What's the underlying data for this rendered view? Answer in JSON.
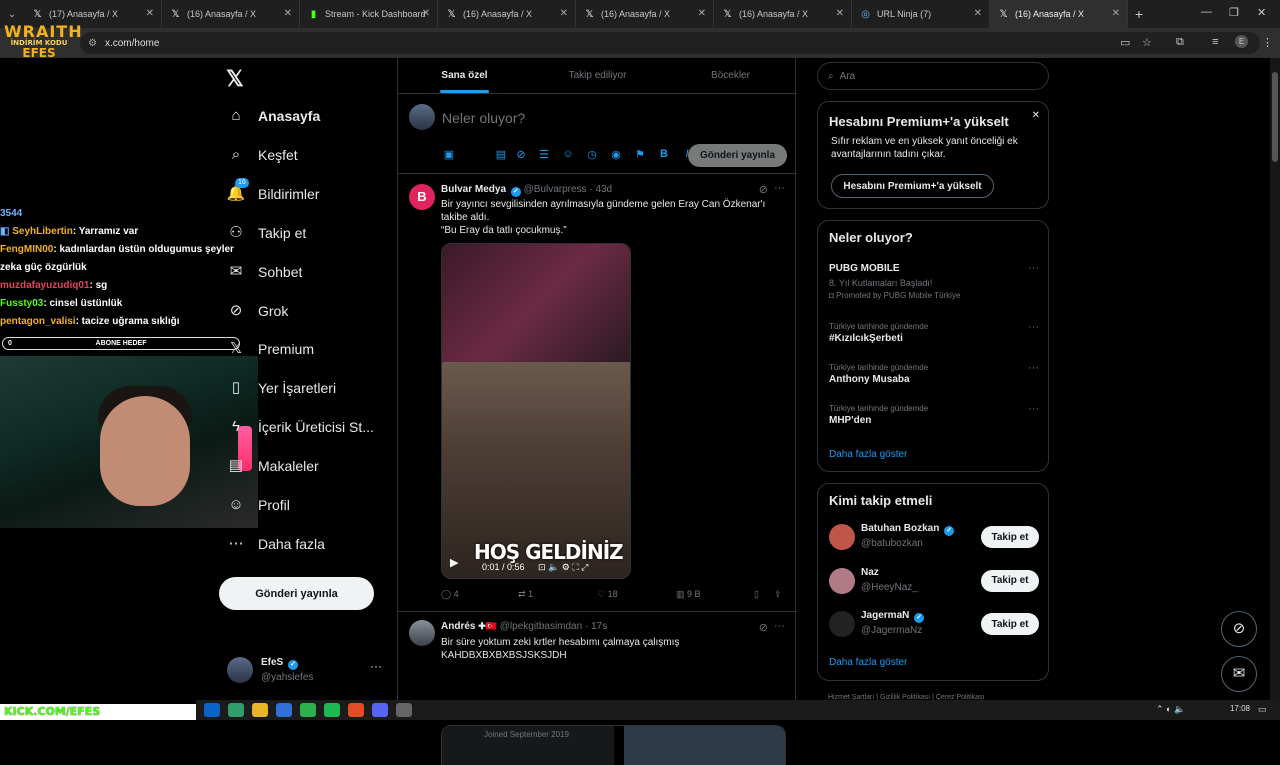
{
  "browser": {
    "tabs": [
      {
        "title": "(17) Anasayfa / X",
        "icon": "x-logo-icon",
        "active": false
      },
      {
        "title": "(16) Anasayfa / X",
        "icon": "x-logo-icon",
        "active": false
      },
      {
        "title": "Stream - Kick Dashboard",
        "icon": "kick-icon",
        "active": false
      },
      {
        "title": "(16) Anasayfa / X",
        "icon": "x-logo-icon",
        "active": false
      },
      {
        "title": "(16) Anasayfa / X",
        "icon": "x-logo-icon",
        "active": false
      },
      {
        "title": "(16) Anasayfa / X",
        "icon": "x-logo-icon",
        "active": false
      },
      {
        "title": "URL Ninja (7)",
        "icon": "globe-icon",
        "active": false
      },
      {
        "title": "(16) Anasayfa / X",
        "icon": "x-logo-icon",
        "active": true
      }
    ],
    "url": "x.com/home",
    "profile_initial": "E"
  },
  "overlay": {
    "logo_line1": "WRAITH",
    "logo_line2": "İNDİRİM KODU",
    "logo_line3": "EFES",
    "chat_count": "3544",
    "chat": [
      {
        "user": "SeyhLibertin",
        "color": "#f3b21b",
        "text": ": Yarramız var"
      },
      {
        "user": "FengMIN00",
        "color": "#f3b21b",
        "text": ": kadınlardan üstün oldugumus şeyler zeka güç özgürlük"
      },
      {
        "user": "muzdafayuzudiq01",
        "color": "#e0455b",
        "text": ": sg"
      },
      {
        "user": "Fussty03",
        "color": "#53fc18",
        "text": ": cinsel üstünlük"
      },
      {
        "user": "pentagon_valisi",
        "color": "#f3b21b",
        "text": ": tacize uğrama sıklığı"
      }
    ],
    "sub_goal_label": "ABONE HEDEF",
    "sub_goal_value": "0",
    "sub_goal_progress": 0,
    "kick_url": "KICK.COM/EFES"
  },
  "nav": {
    "items": [
      {
        "label": "Anasayfa",
        "icon": "home-icon",
        "active": true
      },
      {
        "label": "Keşfet",
        "icon": "search-icon"
      },
      {
        "label": "Bildirimler",
        "icon": "bell-icon",
        "badge": "16"
      },
      {
        "label": "Takip et",
        "icon": "person-add-icon"
      },
      {
        "label": "Sohbet",
        "icon": "mail-icon"
      },
      {
        "label": "Grok",
        "icon": "grok-icon"
      },
      {
        "label": "Premium",
        "icon": "x-premium-icon"
      },
      {
        "label": "Yer İşaretleri",
        "icon": "bookmark-icon"
      },
      {
        "label": "İçerik Üreticisi St...",
        "icon": "lightning-icon"
      },
      {
        "label": "Makaleler",
        "icon": "article-icon"
      },
      {
        "label": "Profil",
        "icon": "person-icon"
      },
      {
        "label": "Daha fazla",
        "icon": "more-circle-icon"
      }
    ],
    "post_button": "Gönderi yayınla",
    "account": {
      "name": "EfeS",
      "handle": "@yahslefes"
    }
  },
  "feed": {
    "tabs": [
      "Sana özel",
      "Takip ediliyor",
      "Böcekler"
    ],
    "active_tab": 0,
    "compose_placeholder": "Neler oluyor?",
    "compose_button": "Gönderi yayınla",
    "tweets": [
      {
        "name": "Bulvar Medya",
        "handle": "@Bulvarpress",
        "time": "43d",
        "text_line1": "Bir yayıncı sevgilisinden ayrılmasıyla gündeme gelen Eray Can Özkenar'ı takibe aldı.",
        "text_line2": "“Bu Eray da tatlı çocukmuş.”",
        "video_overlay": "HOŞ GELDİNİZ",
        "video_time": "0:01 / 0:56",
        "replies": "4",
        "reposts": "1",
        "likes": "18",
        "views": "9 B"
      },
      {
        "name": "Andrés",
        "handle": "@lpekgitbasimdan",
        "time": "17s",
        "text_line1": "Bir süre yoktum zeki krtler hesabımı çalmaya çalışmış",
        "text_line2": "KAHDBXBXBXBSJSKSJDH",
        "card_text": "Joined September 2019"
      }
    ]
  },
  "right": {
    "search_placeholder": "Ara",
    "premium": {
      "title": "Hesabını Premium+'a yükselt",
      "subtitle": "Sıfır reklam ve en yüksek yanıt önceliği ek avantajlarının tadını çıkar.",
      "button": "Hesabını Premium+'a yükselt"
    },
    "trends_title": "Neler oluyor?",
    "trends": [
      {
        "category": "",
        "name": "PUBG MOBILE",
        "sub": "8. Yıl Kutlamaları Başladı!",
        "promoted": "Promoted by PUBG Mobile Türkiye"
      },
      {
        "category": "Türkiye tarihinde gündemde",
        "name": "#KızılcıkŞerbeti"
      },
      {
        "category": "Türkiye tarihinde gündemde",
        "name": "Anthony Musaba"
      },
      {
        "category": "Türkiye tarihinde gündemde",
        "name": "MHP'den"
      }
    ],
    "trends_more": "Daha fazla göster",
    "who_title": "Kimi takip etmeli",
    "who": [
      {
        "name": "Batuhan Bozkan",
        "handle": "@batubozkan",
        "verified": true,
        "color": "#c0564a"
      },
      {
        "name": "Naz",
        "handle": "@HeeyNaz_",
        "verified": false,
        "color": "#b07a86"
      },
      {
        "name": "JagermaN",
        "handle": "@JagermaNz",
        "verified": true,
        "color": "#222222"
      }
    ],
    "follow_button": "Takip et",
    "who_more": "Daha fazla göster",
    "footer": "Hizmet Şartları  |  Gizlilik Politikası  |  Çerez Politikası"
  },
  "taskbar": {
    "time": "17:08"
  }
}
